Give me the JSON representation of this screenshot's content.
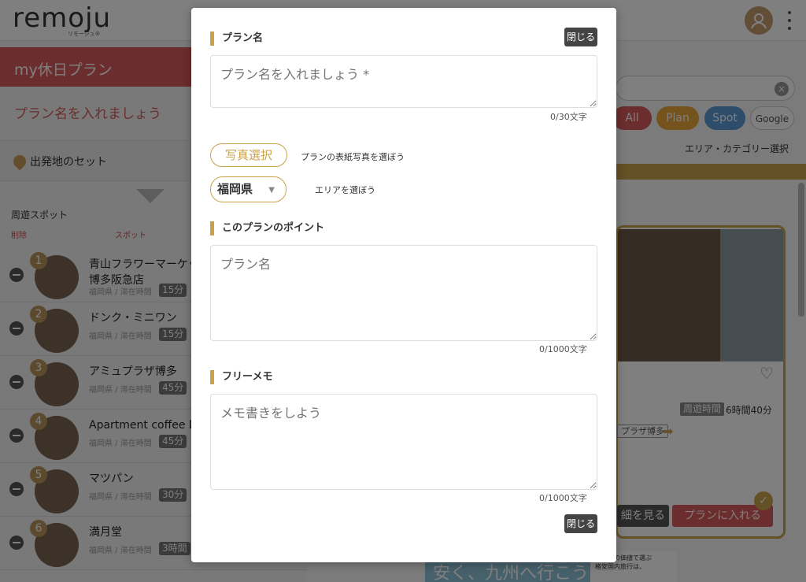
{
  "app": {
    "logo_text": "remoju",
    "logo_sub": "リモージュ®"
  },
  "left_panel": {
    "plan_tab_label": "my休日プラン",
    "plan_name_hint": "プラン名を入れましょう",
    "depart_label": "出発地のセット",
    "section_label": "周遊スポット",
    "col_delete": "削除",
    "col_spot": "スポット",
    "spots": [
      {
        "num": "1",
        "name": "青山フラワーマーケッ",
        "name2": "博多阪急店",
        "meta": "福岡県 / 滞在時間",
        "stay": "15分"
      },
      {
        "num": "2",
        "name": "ドンク・ミニワン",
        "name2": "",
        "meta": "福岡県 / 滞在時間",
        "stay": "15分"
      },
      {
        "num": "3",
        "name": "アミュプラザ博多",
        "name2": "",
        "meta": "福岡県 / 滞在時間",
        "stay": "45分"
      },
      {
        "num": "4",
        "name": "Apartment coffee Do",
        "name2": "",
        "meta": "福岡県 / 滞在時間",
        "stay": "45分"
      },
      {
        "num": "5",
        "name": "マツパン",
        "name2": "",
        "meta": "福岡県 / 滞在時間",
        "stay": "30分"
      },
      {
        "num": "6",
        "name": "満月堂",
        "name2": "",
        "meta": "福岡県 / 滞在時間",
        "stay": "3時間"
      }
    ]
  },
  "right_panel": {
    "chips": [
      "All",
      "Plan",
      "Spot",
      "Google"
    ],
    "area_select": "エリア・カテゴリー選択",
    "tour_time_label": "周遊時間",
    "tour_time_value": "6時間40分",
    "route_tag": "プラザ博多",
    "detail_button": "細を見る",
    "add_button": "プランに入れる",
    "ad_text": "安く、九州へ行こう",
    "ad_small_1": "その値の価値で選ぶ",
    "ad_small_2": "格安国内旅行は、"
  },
  "modal": {
    "plan_name_title": "プラン名",
    "close_label": "閉じる",
    "plan_name_placeholder": "プラン名を入れましょう *",
    "plan_name_counter": "0/30文字",
    "photo_button": "写真選択",
    "photo_hint": "プランの表紙写真を選ぼう",
    "prefecture_value": "福岡県",
    "area_hint": "エリアを選ぼう",
    "point_title": "このプランのポイント",
    "point_placeholder": "プラン名",
    "point_counter": "0/1000文字",
    "memo_title": "フリーメモ",
    "memo_placeholder": "メモ書きをしよう",
    "memo_counter": "0/1000文字"
  },
  "colors": {
    "brand_red": "#d75a5a",
    "brand_gold": "#c9a24a",
    "chip_all": "#d75a5a",
    "chip_plan": "#e8a73a",
    "chip_spot": "#5b9bd5"
  }
}
